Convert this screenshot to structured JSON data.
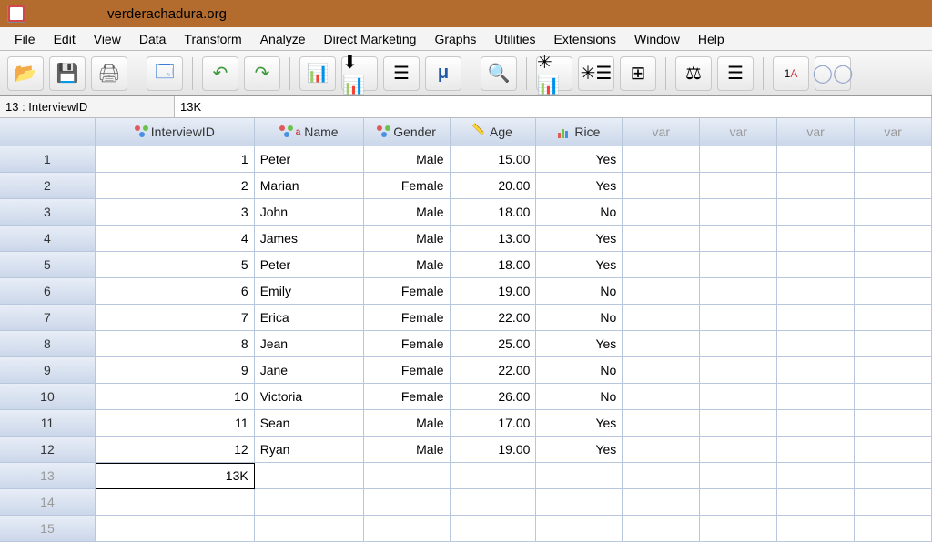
{
  "title_bar": {
    "url": "verderachadura.org"
  },
  "menu": [
    "File",
    "Edit",
    "View",
    "Data",
    "Transform",
    "Analyze",
    "Direct Marketing",
    "Graphs",
    "Utilities",
    "Extensions",
    "Window",
    "Help"
  ],
  "toolbar_icons": [
    "open",
    "save",
    "print",
    "recall",
    "undo",
    "redo",
    "goto-case",
    "goto-var",
    "variables",
    "run-desc",
    "find",
    "insert-case",
    "insert-var",
    "split-file",
    "weight",
    "select-cases",
    "value-labels",
    "use-sets"
  ],
  "editor": {
    "label": "13 : InterviewID",
    "value": "13K"
  },
  "columns": [
    {
      "name": "InterviewID",
      "type": "nominal",
      "width": "w-id",
      "align": "right"
    },
    {
      "name": "Name",
      "type": "string",
      "width": "w-name",
      "align": "left"
    },
    {
      "name": "Gender",
      "type": "nominal",
      "width": "w-gender",
      "align": "right"
    },
    {
      "name": "Age",
      "type": "scale",
      "width": "w-age",
      "align": "right"
    },
    {
      "name": "Rice",
      "type": "bar",
      "width": "w-rice",
      "align": "right"
    }
  ],
  "var_label": "var",
  "rows": [
    {
      "n": "1",
      "cells": [
        "1",
        "Peter",
        "Male",
        "15.00",
        "Yes"
      ]
    },
    {
      "n": "2",
      "cells": [
        "2",
        "Marian",
        "Female",
        "20.00",
        "Yes"
      ]
    },
    {
      "n": "3",
      "cells": [
        "3",
        "John",
        "Male",
        "18.00",
        "No"
      ]
    },
    {
      "n": "4",
      "cells": [
        "4",
        "James",
        "Male",
        "13.00",
        "Yes"
      ]
    },
    {
      "n": "5",
      "cells": [
        "5",
        "Peter",
        "Male",
        "18.00",
        "Yes"
      ]
    },
    {
      "n": "6",
      "cells": [
        "6",
        "Emily",
        "Female",
        "19.00",
        "No"
      ]
    },
    {
      "n": "7",
      "cells": [
        "7",
        "Erica",
        "Female",
        "22.00",
        "No"
      ]
    },
    {
      "n": "8",
      "cells": [
        "8",
        "Jean",
        "Female",
        "25.00",
        "Yes"
      ]
    },
    {
      "n": "9",
      "cells": [
        "9",
        "Jane",
        "Female",
        "22.00",
        "No"
      ]
    },
    {
      "n": "10",
      "cells": [
        "10",
        "Victoria",
        "Female",
        "26.00",
        "No"
      ]
    },
    {
      "n": "11",
      "cells": [
        "11",
        "Sean",
        "Male",
        "17.00",
        "Yes"
      ]
    },
    {
      "n": "12",
      "cells": [
        "12",
        "Ryan",
        "Male",
        "19.00",
        "Yes"
      ]
    }
  ],
  "editing_row": {
    "n": "13",
    "value": "13K"
  },
  "empty_rows": [
    "14",
    "15"
  ]
}
